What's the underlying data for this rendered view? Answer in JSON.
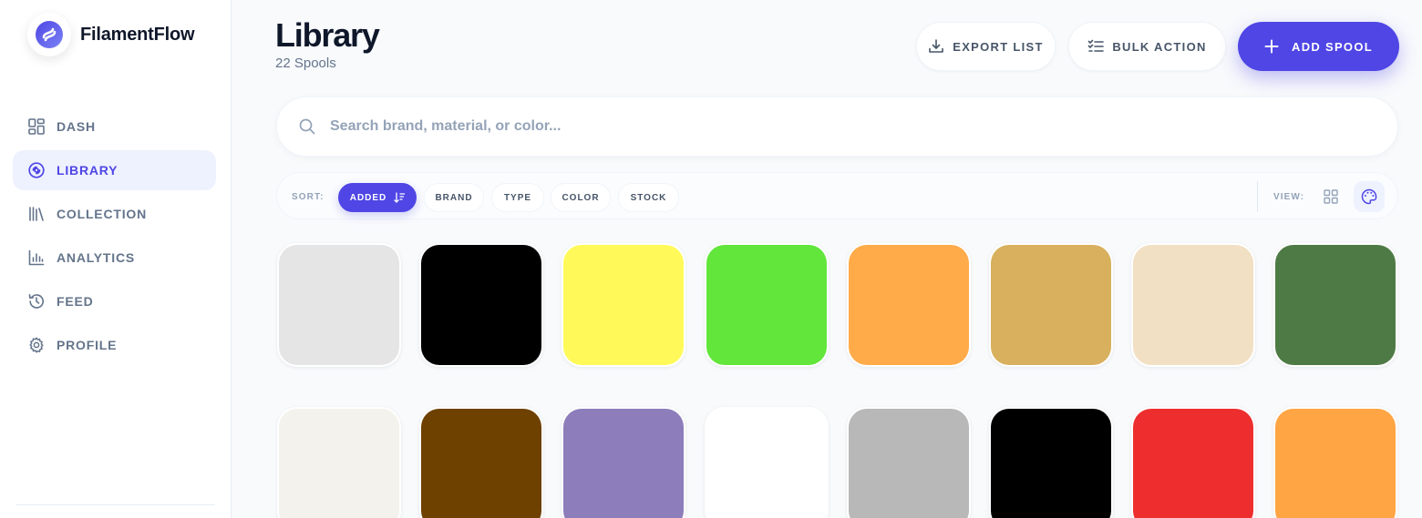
{
  "app": {
    "name": "FilamentFlow",
    "accent": "#4f46e5"
  },
  "nav": {
    "items": [
      {
        "label": "DASH",
        "icon": "dashboard-icon",
        "active": false
      },
      {
        "label": "LIBRARY",
        "icon": "spool-icon",
        "active": true
      },
      {
        "label": "COLLECTION",
        "icon": "books-icon",
        "active": false
      },
      {
        "label": "ANALYTICS",
        "icon": "bar-chart-icon",
        "active": false
      },
      {
        "label": "FEED",
        "icon": "history-icon",
        "active": false
      },
      {
        "label": "PROFILE",
        "icon": "gear-icon",
        "active": false
      }
    ]
  },
  "header": {
    "title": "Library",
    "subtitle": "22 Spools",
    "export_label": "EXPORT LIST",
    "bulk_label": "BULK ACTION",
    "add_label": "ADD SPOOL"
  },
  "search": {
    "placeholder": "Search brand, material, or color...",
    "value": ""
  },
  "toolbar": {
    "sort_label": "SORT:",
    "sort_options": [
      {
        "label": "ADDED",
        "active": true
      },
      {
        "label": "BRAND",
        "active": false
      },
      {
        "label": "TYPE",
        "active": false
      },
      {
        "label": "COLOR",
        "active": false
      },
      {
        "label": "STOCK",
        "active": false
      }
    ],
    "view_label": "VIEW:",
    "view_mode": "palette"
  },
  "swatches": [
    "#e5e5e5",
    "#000000",
    "#fffa5a",
    "#62e63c",
    "#ffab4a",
    "#d8b05e",
    "#f2e0c4",
    "#4e7b45",
    "#f3f2ec",
    "#6e4100",
    "#8d7dba",
    "#ffffff",
    "#b8b8b8",
    "#000000",
    "#ee2e2e",
    "#ffa544"
  ]
}
